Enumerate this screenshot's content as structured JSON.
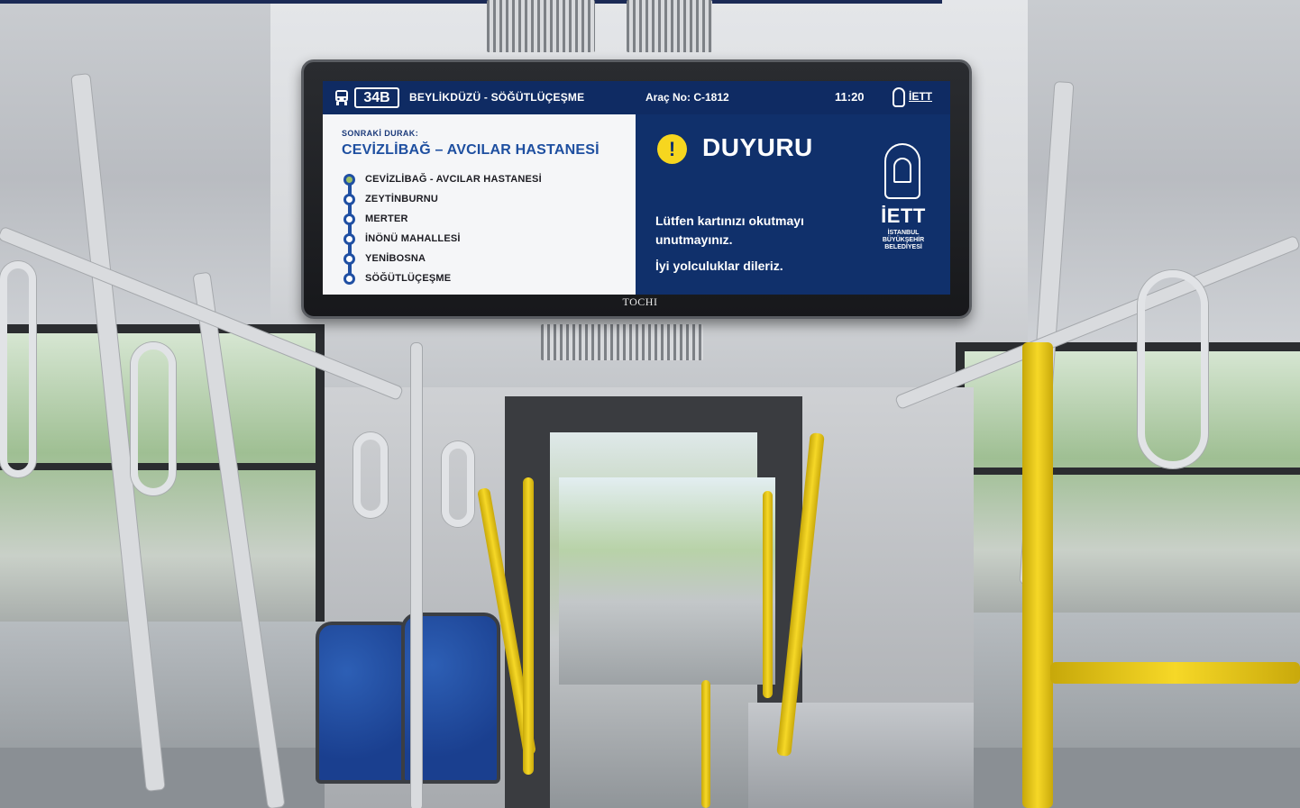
{
  "display": {
    "route_number": "34B",
    "route_name": "BEYLİKDÜZÜ - SÖĞÜTLÜÇEŞME",
    "vehicle_label": "Araç No: C-1812",
    "clock": "11:20",
    "logo_small_text": "İETT",
    "next_stop_label": "SONRAKİ DURAK:",
    "next_stop_name": "CEVİZLİBAĞ – AVCILAR HASTANESİ",
    "stops": [
      {
        "name": "CEVİZLİBAĞ - AVCILAR HASTANESİ",
        "current": true
      },
      {
        "name": "ZEYTİNBURNU",
        "current": false
      },
      {
        "name": "MERTER",
        "current": false
      },
      {
        "name": "İNÖNÜ MAHALLESİ",
        "current": false
      },
      {
        "name": "YENİBOSNA",
        "current": false
      },
      {
        "name": "SÖĞÜTLÜÇEŞME",
        "current": false
      }
    ],
    "notice": {
      "icon": "!",
      "title": "DUYURU",
      "message": "Lütfen kartınızı okutmayı unutmayınız.",
      "farewell": "İyi yolculuklar dileriz."
    },
    "logo_big_text": "İETT",
    "logo_big_sub": "İSTANBUL BÜYÜKŞEHİR BELEDİYESİ",
    "colors": {
      "screen_blue": "#10306b",
      "accent_blue": "#1e4fa0",
      "alert_yellow": "#f6d61f",
      "current_stop_green": "#9cbf63"
    }
  },
  "monitor": {
    "brand": "TOCHI"
  }
}
